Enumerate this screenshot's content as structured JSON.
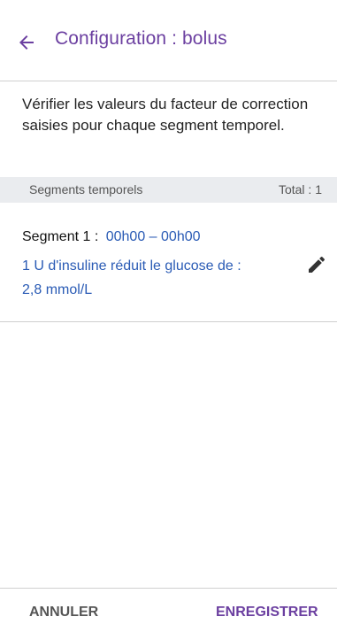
{
  "header": {
    "title": "Configuration : bolus"
  },
  "intro": {
    "text": "Vérifier les valeurs du facteur de correction saisies pour chaque segment temporel."
  },
  "segments_bar": {
    "label": "Segments temporels",
    "total": "Total : 1"
  },
  "segments": [
    {
      "name": "Segment 1 :",
      "time_range": "00h00 – 00h00",
      "description": "1 U d'insuline réduit le glucose de :",
      "value": "2,8 mmol/L"
    }
  ],
  "footer": {
    "cancel_label": "ANNULER",
    "save_label": "ENREGISTRER"
  },
  "icons": {
    "back": "arrow-left-icon",
    "edit": "pencil-icon"
  },
  "colors": {
    "accent": "#6b3fa0",
    "link": "#2a5bb5",
    "bar_bg": "#eaecef"
  }
}
